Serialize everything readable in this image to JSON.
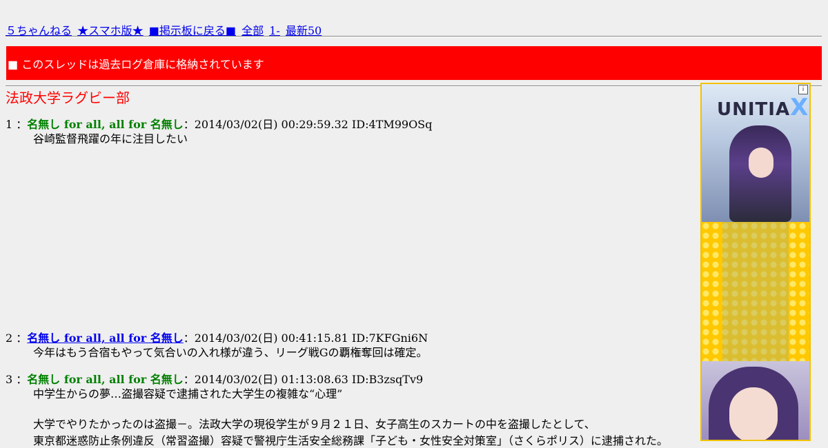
{
  "nav": {
    "site": "５ちゃんねる",
    "smartphone": "★スマホ版★",
    "back_board": "■掲示板に戻る■",
    "all": "全部",
    "first": "1-",
    "latest50": "最新50"
  },
  "banner": "■ このスレッドは過去ログ倉庫に格納されています",
  "thread_title": "法政大学ラグビー部",
  "posts": [
    {
      "num": "1",
      "sep": "：",
      "name": "名無し for all, all for 名無し",
      "meta": "：2014/03/02(日) 00:29:59.32 ID:4TM99OSq",
      "lines": [
        "谷崎監督飛躍の年に注目したい"
      ]
    },
    {
      "num": "2",
      "sep": "：",
      "name": "名無し for all, all for 名無し",
      "meta": "：2014/03/02(日) 00:41:15.81 ID:7KFGni6N",
      "lines": [
        "今年はもう合宿もやって気合いの入れ様が違う、リーグ戦Gの覇権奪回は確定。"
      ]
    },
    {
      "num": "3",
      "sep": "：",
      "name": "名無し for all, all for 名無し",
      "meta": "：2014/03/02(日) 01:13:08.63 ID:B3zsqTv9",
      "lines": [
        "中学生からの夢…盗撮容疑で逮捕された大学生の複雑な“心理”",
        "",
        "大学でやりたかったのは盗撮－。法政大学の現役学生が９月２１日、女子高生のスカートの中を盗撮したとして、",
        "東京都迷惑防止条例違反（常習盗撮）容疑で警視庁生活安全総務課「子ども・女性安全対策室」（さくらポリス）に逮捕された。"
      ]
    }
  ],
  "ad": {
    "logo": "UNITIA",
    "logo_mark": "X",
    "info_icon": "i"
  },
  "colors": {
    "background": "#efefef",
    "banner": "#ff0000",
    "title": "#ff0000",
    "name_green": "#008000",
    "link": "#0000ee"
  }
}
